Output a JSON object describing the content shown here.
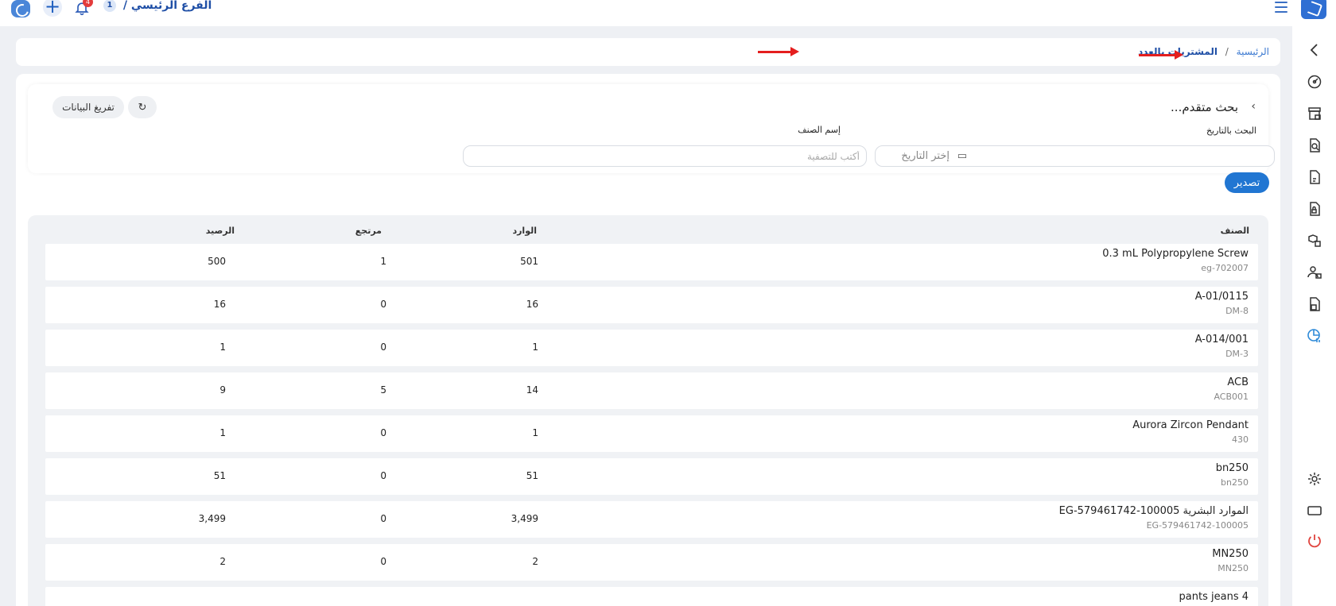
{
  "topbar": {
    "branch_num": "1",
    "branch_label": "الفرع الرئيسي /",
    "notification_count": "4"
  },
  "breadcrumb": {
    "home": "الرئيسية",
    "separator": "/",
    "current": "المشتريات بالعدد"
  },
  "search": {
    "title": "بحث متقدم...",
    "date_label": "البحث بالتاريخ",
    "date_placeholder": "إختر التاريخ",
    "item_label": "إسم الصنف",
    "item_placeholder": "أكتب للتصفية",
    "reset_label": "تفريغ البيانات"
  },
  "export_label": "تصدير",
  "table": {
    "headers": {
      "item": "الصنف",
      "incoming": "الوارد",
      "returned": "مرتجع",
      "balance": "الرصيد"
    },
    "rows": [
      {
        "name": "0.3 mL Polypropylene Screw",
        "code": "eg-702007",
        "incoming": "501",
        "returned": "1",
        "balance": "500"
      },
      {
        "name": "A-01/0115",
        "code": "DM-8",
        "incoming": "16",
        "returned": "0",
        "balance": "16"
      },
      {
        "name": "A-014/001",
        "code": "DM-3",
        "incoming": "1",
        "returned": "0",
        "balance": "1"
      },
      {
        "name": "ACB",
        "code": "ACB001",
        "incoming": "14",
        "returned": "5",
        "balance": "9"
      },
      {
        "name": "Aurora Zircon Pendant",
        "code": "430",
        "incoming": "1",
        "returned": "0",
        "balance": "1"
      },
      {
        "name": "bn250",
        "code": "bn250",
        "incoming": "51",
        "returned": "0",
        "balance": "51"
      },
      {
        "name": "EG-579461742-100005 الموارد البشرية",
        "code": "EG-579461742-100005",
        "incoming": "3,499",
        "returned": "0",
        "balance": "3,499"
      },
      {
        "name": "MN250",
        "code": "MN250",
        "incoming": "2",
        "returned": "0",
        "balance": "2"
      },
      {
        "name": "pants jeans 4",
        "code": "",
        "incoming": "",
        "returned": "",
        "balance": ""
      }
    ]
  },
  "colors": {
    "primary": "#2176d2",
    "annotation_arrow": "#e41e1e",
    "active_sidebar": "#2e8ad8",
    "logout": "#e0443e"
  },
  "sidebar_icons": [
    "chevron-left-icon",
    "dashboard-icon",
    "store-icon",
    "search-doc-icon",
    "invoice-icon",
    "lock-doc-icon",
    "boxes-icon",
    "users-icon",
    "report-icon",
    "chart-report-icon",
    "settings-icon",
    "screen-icon",
    "power-icon"
  ]
}
